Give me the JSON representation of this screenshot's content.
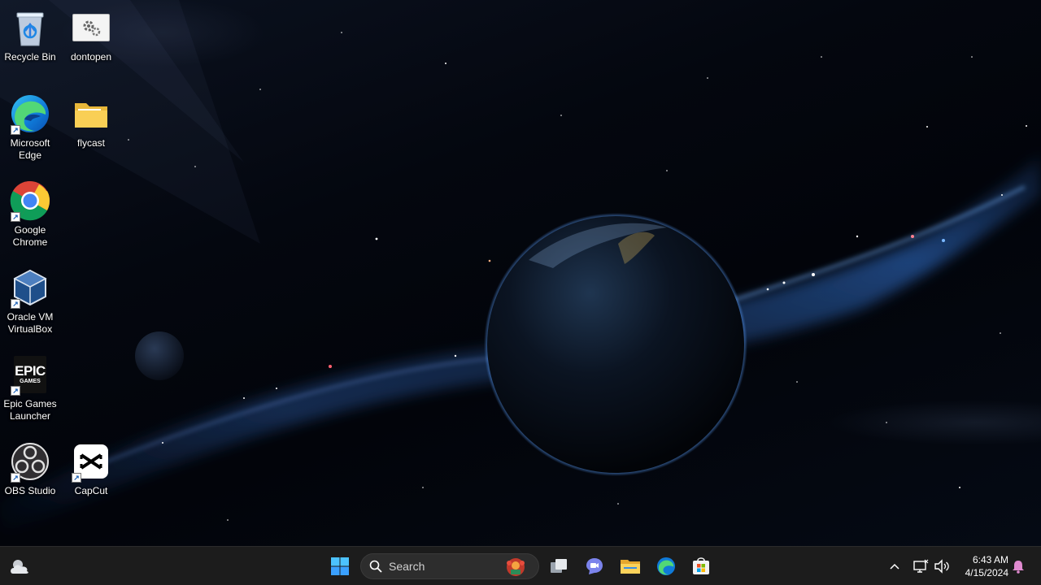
{
  "desktop": {
    "icons": [
      {
        "label": "Recycle Bin",
        "icon": "recycle-bin-icon",
        "shortcut": false
      },
      {
        "label": "dontopen",
        "icon": "settings-file-icon",
        "shortcut": false
      },
      {
        "label": "Microsoft Edge",
        "icon": "edge-icon",
        "shortcut": true
      },
      {
        "label": "flycast",
        "icon": "folder-icon",
        "shortcut": false
      },
      {
        "label": "Google Chrome",
        "icon": "chrome-icon",
        "shortcut": true
      },
      {
        "label": "Oracle VM VirtualBox",
        "icon": "virtualbox-icon",
        "shortcut": true
      },
      {
        "label": "Epic Games Launcher",
        "icon": "epic-games-icon",
        "shortcut": true
      },
      {
        "label": "OBS Studio",
        "icon": "obs-icon",
        "shortcut": true
      },
      {
        "label": "CapCut",
        "icon": "capcut-icon",
        "shortcut": true
      }
    ],
    "epic_logo_text": "EPIC",
    "epic_logo_sub": "GAMES"
  },
  "taskbar": {
    "search_placeholder": "Search",
    "apps": [
      "task-view-icon",
      "teams-chat-icon",
      "file-explorer-icon",
      "edge-icon",
      "microsoft-store-icon"
    ],
    "clock": {
      "time": "6:43 AM",
      "date": "4/15/2024"
    }
  },
  "colors": {
    "taskbar_bg": "#1c1c1c",
    "accent_blue": "#3aa0ff",
    "notification_pink": "#e08ad0"
  }
}
